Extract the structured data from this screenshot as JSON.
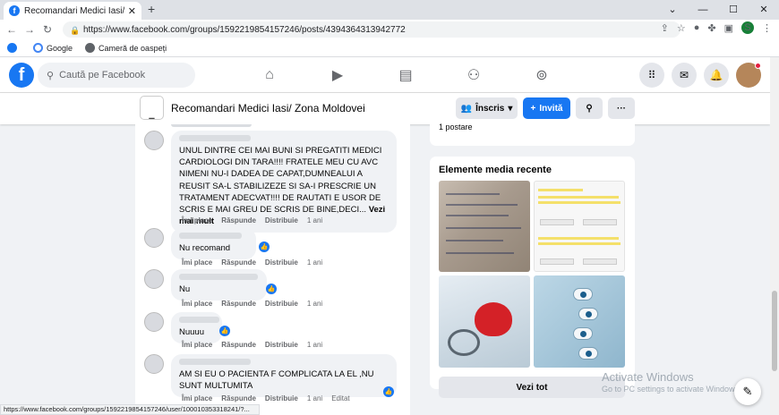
{
  "browser": {
    "tab_title": "Recomandari Medici Iasi/ Zona M",
    "url": "https://www.facebook.com/groups/1592219854157246/posts/4394364313942772",
    "profile_letter": "S",
    "bookmarks": [
      "Google",
      "Cameră de oaspeți"
    ],
    "status_url": "https://www.facebook.com/groups/1592219854157246/user/100010353318241/?..."
  },
  "fb": {
    "logo": "f",
    "search_placeholder": "Caută pe Facebook"
  },
  "group": {
    "name": "Recomandari Medici Iasi/ Zona Moldovei",
    "join_label": "Înscris",
    "invite_label": "Invită"
  },
  "comments": [
    {
      "text": "UNUL DINTRE CEI MAI BUNI SI PREGATITI MEDICI CARDIOLOGI DIN TARA!!!! FRATELE MEU CU AVC NIMENI NU-I DADEA DE CAPAT,DUMNEALUI A REUSIT SA-L STABILIZEZE SI SA-I PRESCRIE UN TRATAMENT ADECVAT!!!! DE RAUTATI E USOR DE SCRIS E MAI GREU DE SCRIS DE BINE,DECI...",
      "more": "Vezi mai mult",
      "time": "1 ani"
    },
    {
      "text": "Nu recomand",
      "time": "1 ani"
    },
    {
      "text": "Nu",
      "time": "1 ani"
    },
    {
      "text": "Nuuuu",
      "time": "1 ani"
    },
    {
      "text": "AM SI EU O PACIENTA F COMPLICATA LA EL ,NU SUNT MULTUMITA",
      "time": "1 ani",
      "edited": "Editat"
    }
  ],
  "actions": {
    "like": "Îmi place",
    "reply": "Răspunde",
    "share": "Distribuie"
  },
  "sidebar": {
    "posts_count": "1 postare",
    "media_title": "Elemente media recente",
    "see_all": "Vezi tot"
  },
  "watermark": {
    "line1": "Activate Windows",
    "line2": "Go to PC settings to activate Windows."
  },
  "colors": {
    "brand": "#1877f2",
    "background": "#f0f2f5"
  }
}
